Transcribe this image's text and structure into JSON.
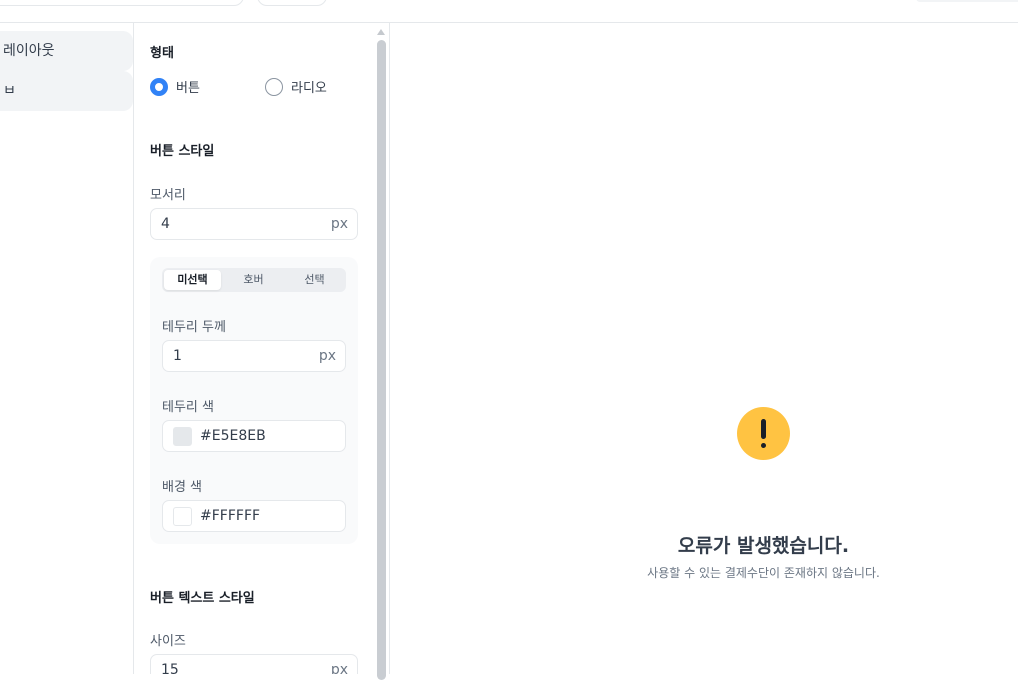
{
  "left_nav": {
    "items": [
      {
        "label": "레이아웃"
      },
      {
        "label": "ㅂ"
      }
    ]
  },
  "panel": {
    "shape_title": "형태",
    "shape_options": [
      {
        "label": "버튼",
        "checked": true
      },
      {
        "label": "라디오",
        "checked": false
      }
    ],
    "button_style_title": "버튼 스타일",
    "corner_label": "모서리",
    "corner_value": "4",
    "corner_unit": "px",
    "state_tabs": [
      "미선택",
      "호버",
      "선택"
    ],
    "active_state_tab": "미선택",
    "border_width_label": "테두리 두께",
    "border_width_value": "1",
    "border_width_unit": "px",
    "border_color_label": "테두리 색",
    "border_color_value": "#E5E8EB",
    "bg_color_label": "배경 색",
    "bg_color_value": "#FFFFFF",
    "text_style_title": "버튼 텍스트 스타일",
    "size_label": "사이즈",
    "size_value": "15",
    "size_unit": "px"
  },
  "preview": {
    "error_icon": "exclamation-icon",
    "error_title": "오류가 발생했습니다.",
    "error_desc": "사용할 수 있는 결제수단이 존재하지 않습니다."
  },
  "colors": {
    "accent": "#3182f6",
    "warning": "#ffc342",
    "border": "#e5e8eb"
  }
}
